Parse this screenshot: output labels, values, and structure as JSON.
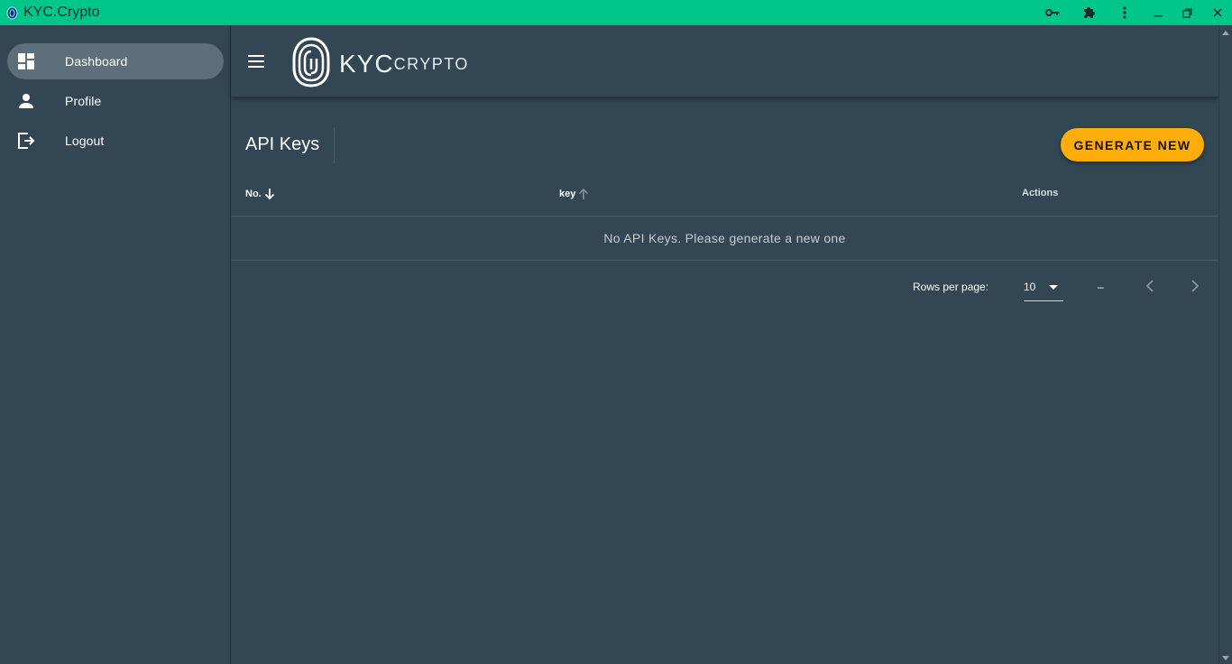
{
  "window": {
    "title": "KYC.Crypto",
    "app_icon": "fingerprint-icon",
    "controls": [
      "key-icon",
      "extension-icon",
      "more-vert-icon",
      "minimize-icon",
      "restore-icon",
      "close-icon"
    ]
  },
  "sidebar": {
    "items": [
      {
        "label": "Dashboard",
        "icon": "dashboard-icon",
        "active": true
      },
      {
        "label": "Profile",
        "icon": "person-icon",
        "active": false
      },
      {
        "label": "Logout",
        "icon": "logout-icon",
        "active": false
      }
    ]
  },
  "header": {
    "logo_main": "KYC",
    "logo_sub": "CRYPTO",
    "logo_icon": "fingerprint-logo-icon"
  },
  "main": {
    "title": "API Keys",
    "generate_button": "GENERATE NEW",
    "table": {
      "columns": [
        {
          "label": "No.",
          "sort": "desc"
        },
        {
          "label": "key",
          "sort": "asc-inactive"
        },
        {
          "label": "Actions",
          "sort": null
        }
      ],
      "empty_message": "No API Keys. Please generate a new one"
    },
    "pagination": {
      "rows_per_page_label": "Rows per page:",
      "rows_per_page_value": "10",
      "range": "–"
    }
  },
  "colors": {
    "titlebar": "#00c68a",
    "background": "#324654",
    "accent_button": "#ffad0a",
    "active_nav": "#5c6f7b"
  }
}
